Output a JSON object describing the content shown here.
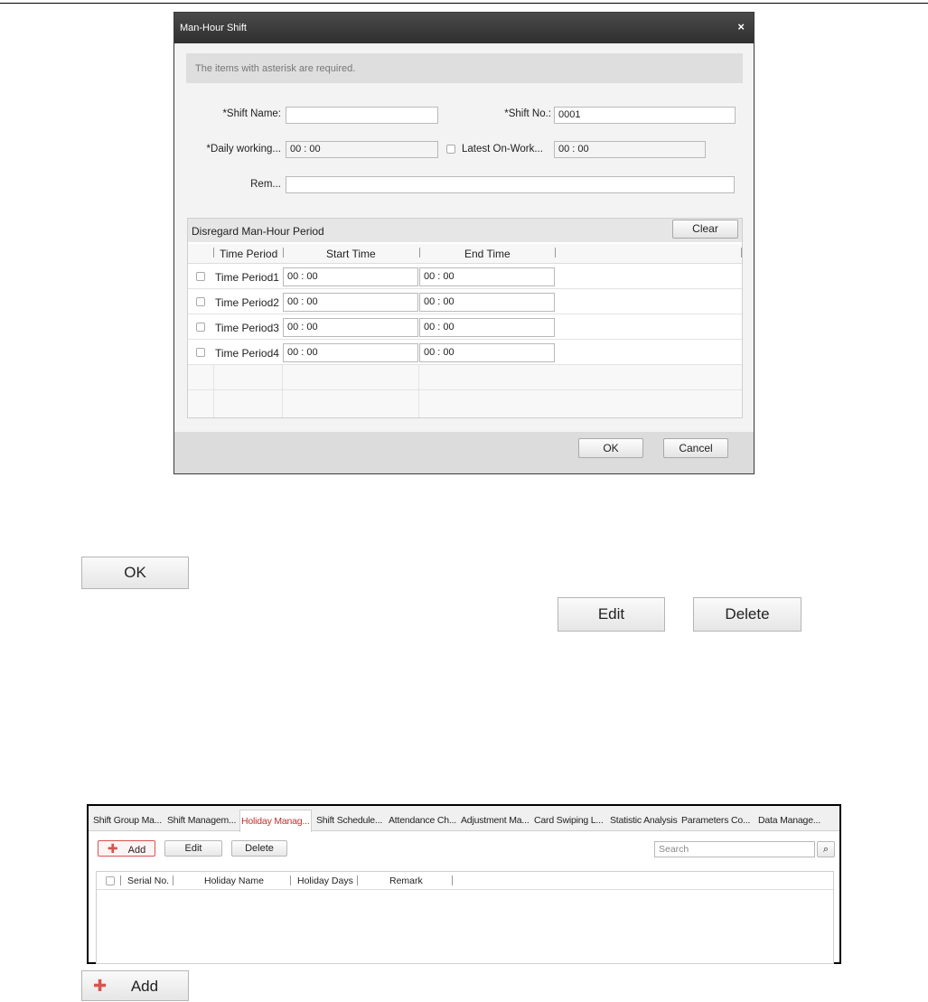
{
  "dialog": {
    "title": "Man-Hour Shift",
    "close": "×",
    "notice": "The items with asterisk are required.",
    "shift_name_label": "*Shift Name:",
    "shift_name_value": "",
    "shift_no_label": "*Shift No.:",
    "shift_no_value": "0001",
    "daily_working_label": "*Daily working...",
    "daily_working_value": "00 : 00",
    "latest_onwork_label": "Latest On-Work...",
    "latest_onwork_value": "00 : 00",
    "remark_label": "Rem...",
    "remark_value": "",
    "period": {
      "title": "Disregard Man-Hour Period",
      "clear": "Clear",
      "columns": [
        "Time Period",
        "Start Time",
        "End Time"
      ],
      "rows": [
        {
          "name": "Time Period1",
          "start": "00 : 00",
          "end": "00 : 00"
        },
        {
          "name": "Time Period2",
          "start": "00 : 00",
          "end": "00 : 00"
        },
        {
          "name": "Time Period3",
          "start": "00 : 00",
          "end": "00 : 00"
        },
        {
          "name": "Time Period4",
          "start": "00 : 00",
          "end": "00 : 00"
        }
      ]
    },
    "ok": "OK",
    "cancel": "Cancel"
  },
  "buttons": {
    "ok": "OK",
    "edit": "Edit",
    "delete": "Delete",
    "add": "Add",
    "add_icon": "✚"
  },
  "holiday": {
    "tabs": [
      "Shift Group Ma...",
      "Shift Managem...",
      "Holiday Manag...",
      "Shift Schedule...",
      "Attendance Ch...",
      "Adjustment Ma...",
      "Card Swiping L...",
      "Statistic Analysis",
      "Parameters Co...",
      "Data Manage..."
    ],
    "active_tab": "Holiday Manag...",
    "add": "Add",
    "edit": "Edit",
    "delete": "Delete",
    "search_placeholder": "Search",
    "columns": [
      "Serial No.",
      "Holiday Name",
      "Holiday Days",
      "Remark"
    ]
  }
}
